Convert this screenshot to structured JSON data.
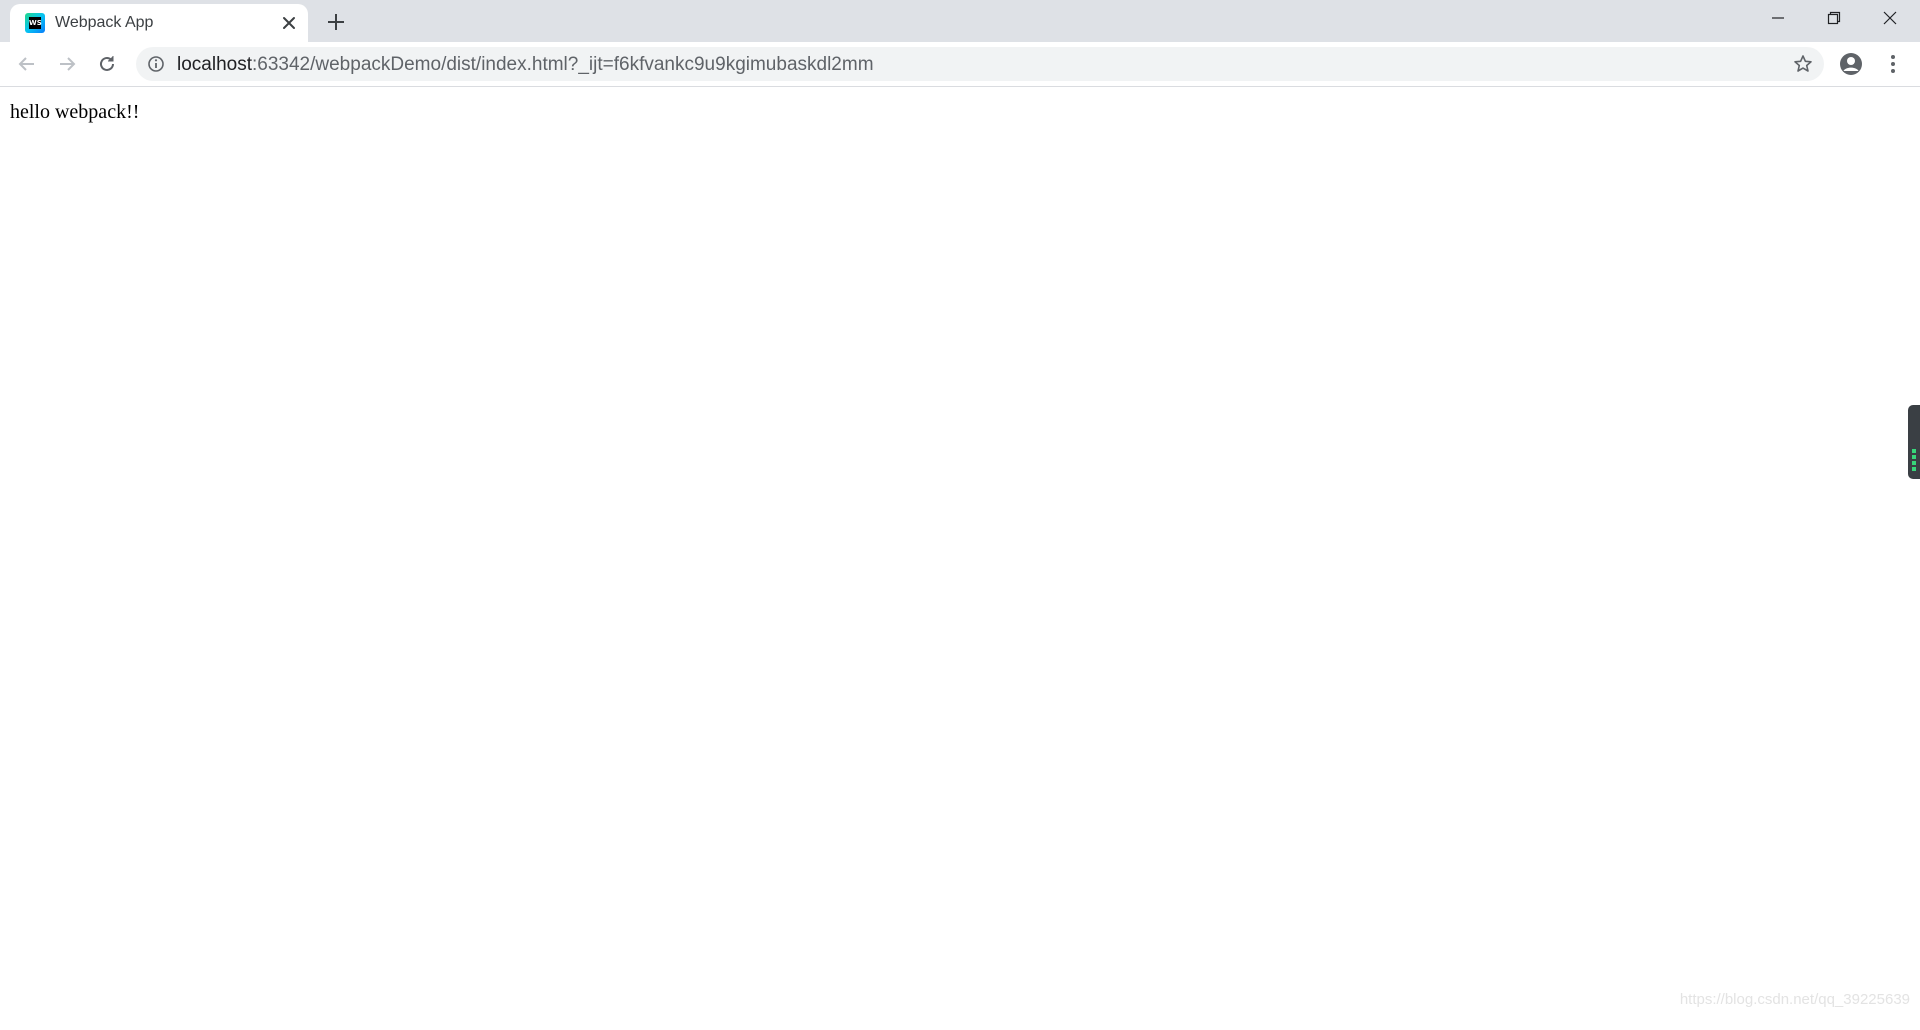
{
  "tab": {
    "title": "Webpack App",
    "favicon_label": "WS"
  },
  "address_bar": {
    "host": "localhost",
    "path": ":63342/webpackDemo/dist/index.html?_ijt=f6kfvankc9u9kgimubaskdl2mm"
  },
  "icons": {
    "back": "back-arrow-icon",
    "forward": "forward-arrow-icon",
    "reload": "reload-icon",
    "info": "info-icon",
    "bookmark": "star-icon",
    "profile": "profile-icon",
    "menu": "kebab-menu-icon",
    "minimize": "minimize-icon",
    "maximize": "restore-icon",
    "close": "close-icon",
    "new_tab": "plus-icon"
  },
  "page": {
    "body_text": "hello webpack!!"
  },
  "watermark": "https://blog.csdn.net/qq_39225639",
  "colors": {
    "tabstrip": "#dee1e6",
    "omnibox": "#f1f3f4",
    "url_host": "#202124",
    "url_rest": "#5f6368"
  }
}
